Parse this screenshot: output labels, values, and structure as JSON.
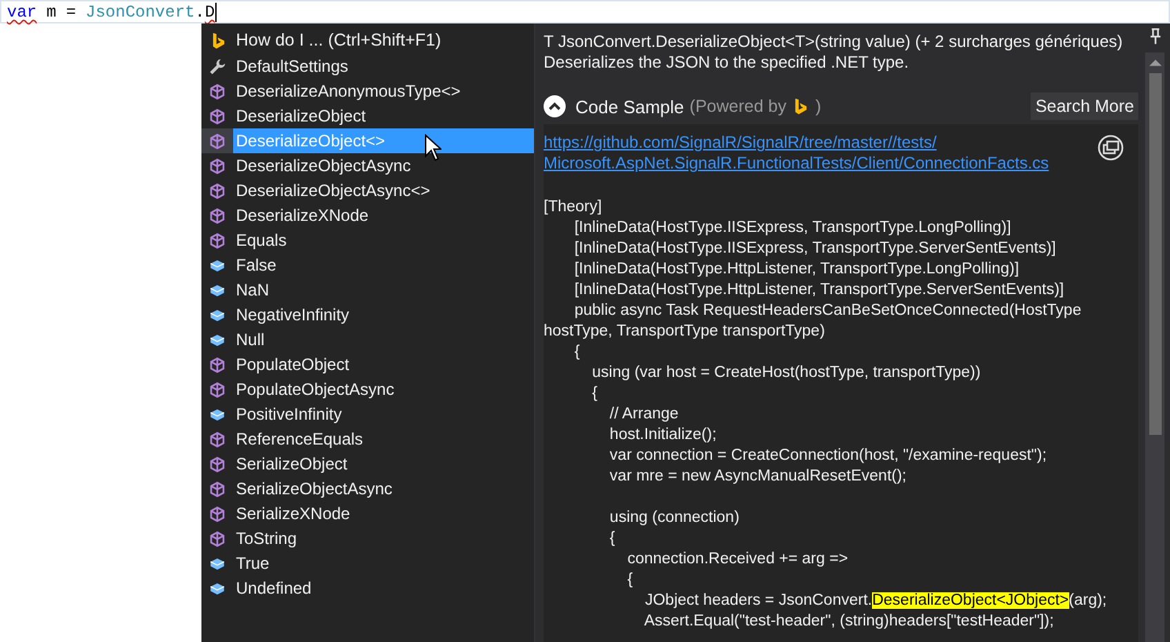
{
  "editor": {
    "words": [
      {
        "parts": [
          {
            "text": "var",
            "kind": "keyword",
            "error": true
          }
        ]
      },
      {
        "parts": [
          {
            "text": "m",
            "kind": "plain",
            "error": false
          }
        ]
      },
      {
        "parts": [
          {
            "text": "=",
            "kind": "plain",
            "error": false
          }
        ]
      },
      {
        "parts": [
          {
            "text": "JsonConvert",
            "kind": "type",
            "error": false
          },
          {
            "text": ".",
            "kind": "plain",
            "error": false
          },
          {
            "text": "D",
            "kind": "plain",
            "error": true
          }
        ]
      }
    ]
  },
  "completion": {
    "header": "How do I ...  (Ctrl+Shift+F1)",
    "items": [
      {
        "label": "DefaultSettings",
        "kind": "property",
        "selected": false
      },
      {
        "label": "DeserializeAnonymousType<>",
        "kind": "method",
        "selected": false
      },
      {
        "label": "DeserializeObject",
        "kind": "method",
        "selected": false
      },
      {
        "label": "DeserializeObject<>",
        "kind": "method",
        "selected": true
      },
      {
        "label": "DeserializeObjectAsync",
        "kind": "method",
        "selected": false
      },
      {
        "label": "DeserializeObjectAsync<>",
        "kind": "method",
        "selected": false
      },
      {
        "label": "DeserializeXNode",
        "kind": "method",
        "selected": false
      },
      {
        "label": "Equals",
        "kind": "method",
        "selected": false
      },
      {
        "label": "False",
        "kind": "field",
        "selected": false
      },
      {
        "label": "NaN",
        "kind": "field",
        "selected": false
      },
      {
        "label": "NegativeInfinity",
        "kind": "field",
        "selected": false
      },
      {
        "label": "Null",
        "kind": "field",
        "selected": false
      },
      {
        "label": "PopulateObject",
        "kind": "method",
        "selected": false
      },
      {
        "label": "PopulateObjectAsync",
        "kind": "method",
        "selected": false
      },
      {
        "label": "PositiveInfinity",
        "kind": "field",
        "selected": false
      },
      {
        "label": "ReferenceEquals",
        "kind": "method",
        "selected": false
      },
      {
        "label": "SerializeObject",
        "kind": "method",
        "selected": false
      },
      {
        "label": "SerializeObjectAsync",
        "kind": "method",
        "selected": false
      },
      {
        "label": "SerializeXNode",
        "kind": "method",
        "selected": false
      },
      {
        "label": "ToString",
        "kind": "method",
        "selected": false
      },
      {
        "label": "True",
        "kind": "field",
        "selected": false
      },
      {
        "label": "Undefined",
        "kind": "field",
        "selected": false
      }
    ]
  },
  "details": {
    "signature": "T JsonConvert.DeserializeObject<T>(string value) (+ 2 surcharges génériques)",
    "description": "Deserializes the JSON to the specified .NET type.",
    "sample_title": "Code Sample",
    "powered_by": "(Powered by",
    "powered_close": ")",
    "search_more": "Search More",
    "link_lines": [
      "https://github.com/SignalR/SignalR/tree/master//tests/",
      "Microsoft.AspNet.SignalR.FunctionalTests/Client/ConnectionFacts.cs"
    ],
    "code_lines": [
      {
        "text": "[Theory]"
      },
      {
        "text": "       [InlineData(HostType.IISExpress, TransportType.LongPolling)]"
      },
      {
        "text": "       [InlineData(HostType.IISExpress, TransportType.ServerSentEvents)]"
      },
      {
        "text": "       [InlineData(HostType.HttpListener, TransportType.LongPolling)]"
      },
      {
        "text": "       [InlineData(HostType.HttpListener, TransportType.ServerSentEvents)]"
      },
      {
        "text": "       public async Task RequestHeadersCanBeSetOnceConnected(HostType"
      },
      {
        "text": "hostType, TransportType transportType)"
      },
      {
        "text": "       {"
      },
      {
        "text": "           using (var host = CreateHost(hostType, transportType))"
      },
      {
        "text": "           {"
      },
      {
        "text": "               // Arrange"
      },
      {
        "text": "               host.Initialize();"
      },
      {
        "text": "               var connection = CreateConnection(host, \"/examine-request\");"
      },
      {
        "text": "               var mre = new AsyncManualResetEvent();"
      },
      {
        "text": "               using (connection)",
        "blank_before": true
      },
      {
        "text": "               {"
      },
      {
        "text": "                   connection.Received += arg =>"
      },
      {
        "text": "                   {"
      },
      {
        "parts": [
          {
            "text": "                       JObject headers = JsonConvert.",
            "highlighted": false
          },
          {
            "text": "DeserializeObject<JObject>",
            "highlighted": true
          },
          {
            "text": "(arg);",
            "highlighted": false
          }
        ]
      },
      {
        "text": "                       Assert.Equal(\"test-header\", (string)headers[\"testHeader\"]);"
      }
    ]
  }
}
